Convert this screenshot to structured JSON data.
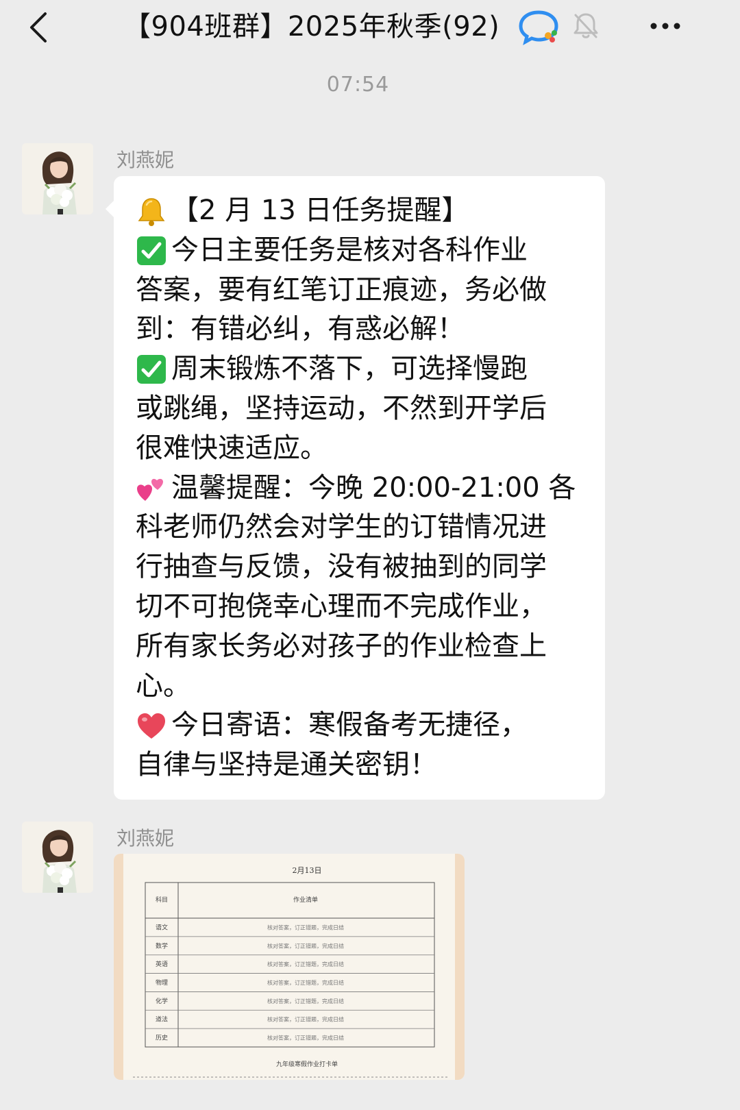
{
  "header": {
    "title": "【904班群】2025年秋季(92)"
  },
  "timestamp": "07:54",
  "messages": [
    {
      "sender": "刘燕妮",
      "type": "text",
      "lines": [
        {
          "emoji": "bell",
          "text": "【2 月 13 日任务提醒】"
        },
        {
          "emoji": "check",
          "text": "今日主要任务是核对各科作业"
        },
        {
          "text": "答案，要有红笔订正痕迹，务必做"
        },
        {
          "text": "到：有错必纠，有惑必解！"
        },
        {
          "emoji": "check",
          "text": "周末锻炼不落下，可选择慢跑"
        },
        {
          "text": "或跳绳，坚持运动，不然到开学后"
        },
        {
          "text": "很难快速适应。"
        },
        {
          "emoji": "hearts",
          "text": "温馨提醒：今晚 20:00-21:00 各"
        },
        {
          "text": "科老师仍然会对学生的订错情况进"
        },
        {
          "text": "行抽查与反馈，没有被抽到的同学"
        },
        {
          "text": "切不可抱侥幸心理而不完成作业，"
        },
        {
          "text": "所有家长务必对孩子的作业检查上"
        },
        {
          "text": "心。"
        },
        {
          "emoji": "heart",
          "text": "今日寄语：寒假备考无捷径，"
        },
        {
          "text": "自律与坚持是通关密钥！"
        }
      ]
    },
    {
      "sender": "刘燕妮",
      "type": "image",
      "doc": {
        "heading": "2月13日",
        "columns": [
          "科目",
          "作业清单"
        ],
        "rows": [
          {
            "subject": "语文",
            "content": "核对答案，订正错题，完成日结"
          },
          {
            "subject": "数学",
            "content": "核对答案，订正错题，完成日结"
          },
          {
            "subject": "英语",
            "content": "核对答案，订正错题，完成日结"
          },
          {
            "subject": "物理",
            "content": "核对答案，订正错题，完成日结"
          },
          {
            "subject": "化学",
            "content": "核对答案，订正错题，完成日结"
          },
          {
            "subject": "道法",
            "content": "核对答案，订正错题，完成日结"
          },
          {
            "subject": "历史",
            "content": "核对答案，订正错题，完成日结"
          }
        ],
        "footer": "九年级寒假作业打卡单"
      }
    }
  ],
  "colors": {
    "background": "#ececec",
    "bubble": "#ffffff",
    "sender": "#8f8f8f",
    "timestamp": "#9a9a9a",
    "check": "#2eb84b",
    "bell": "#f3b51a",
    "heart": "#e8465a"
  },
  "icons": [
    "chevron-left-icon",
    "work-chat-icon",
    "bell-muted-icon",
    "more-icon",
    "bell-icon",
    "check-mark-icon",
    "two-hearts-icon",
    "heart-icon"
  ]
}
